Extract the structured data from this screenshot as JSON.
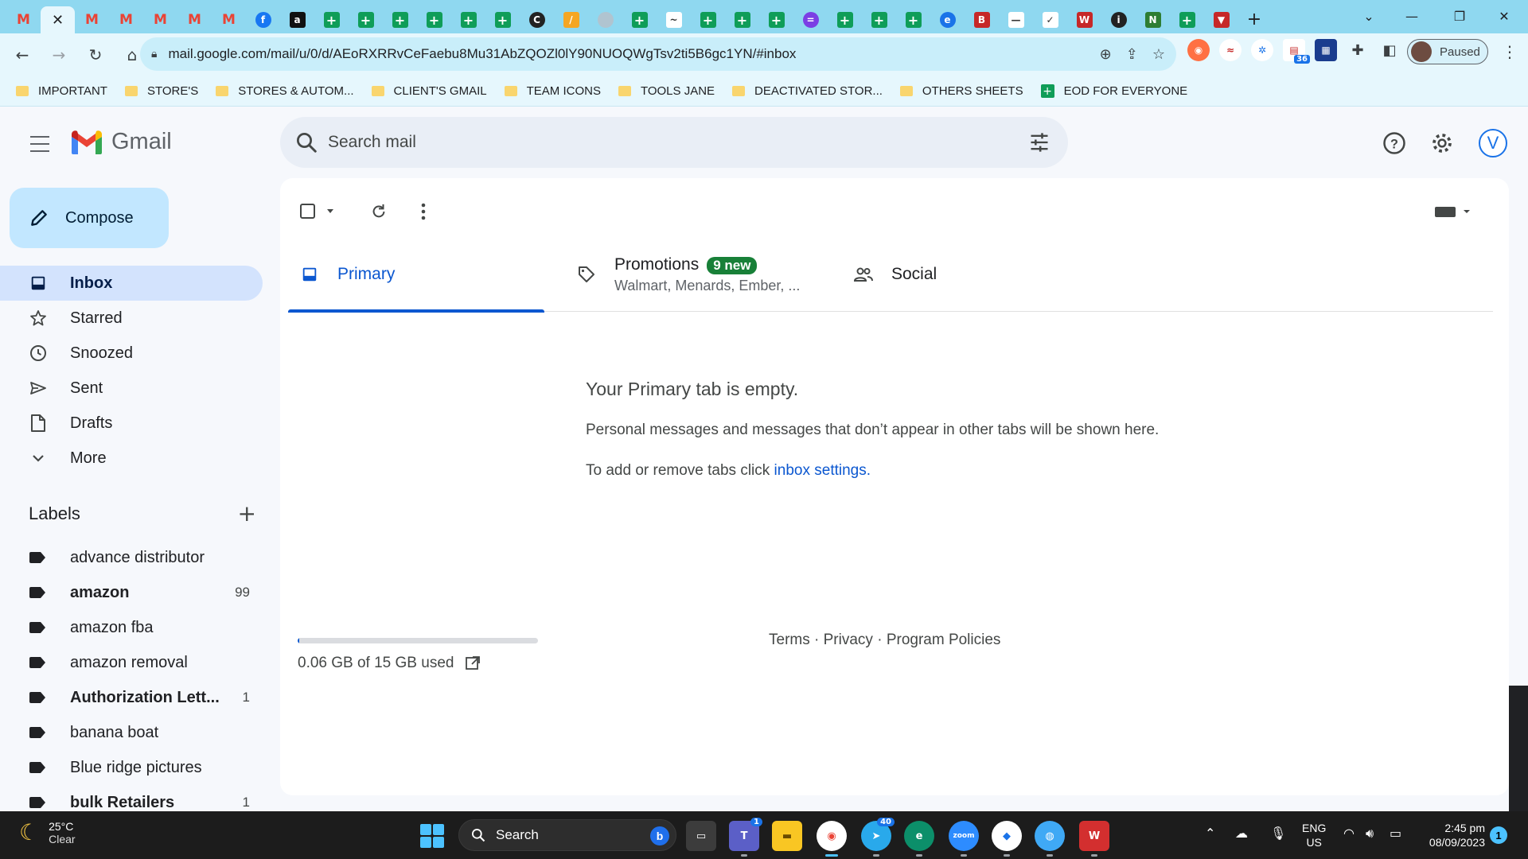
{
  "browser": {
    "tabs": [
      {
        "icon": "gmail-icon",
        "glyph": "M",
        "kind": "gmail"
      },
      {
        "icon": "gmail-icon",
        "glyph": "M",
        "kind": "gmail",
        "active": true
      },
      {
        "icon": "gmail-icon",
        "glyph": "M",
        "kind": "gmail"
      },
      {
        "icon": "gmail-icon",
        "glyph": "M",
        "kind": "gmail"
      },
      {
        "icon": "gmail-icon",
        "glyph": "M",
        "kind": "gmail"
      },
      {
        "icon": "gmail-icon",
        "glyph": "M",
        "kind": "gmail"
      },
      {
        "icon": "gmail-icon",
        "glyph": "M",
        "kind": "gmail"
      },
      {
        "icon": "facebook-icon",
        "glyph": "f",
        "kind": "fb"
      },
      {
        "icon": "amazon-icon",
        "glyph": "a",
        "kind": "amz"
      },
      {
        "icon": "sheets-icon",
        "glyph": "+",
        "kind": "sheet"
      },
      {
        "icon": "sheets-icon",
        "glyph": "+",
        "kind": "sheet"
      },
      {
        "icon": "sheets-icon",
        "glyph": "+",
        "kind": "sheet"
      },
      {
        "icon": "sheets-icon",
        "glyph": "+",
        "kind": "sheet"
      },
      {
        "icon": "sheets-icon",
        "glyph": "+",
        "kind": "sheet"
      },
      {
        "icon": "sheets-icon",
        "glyph": "+",
        "kind": "sheet"
      },
      {
        "icon": "circle-app-icon",
        "glyph": "C",
        "kind": "dark"
      },
      {
        "icon": "tool-icon",
        "glyph": "/",
        "kind": "tool"
      },
      {
        "icon": "grey-circle-icon",
        "glyph": "",
        "kind": "grey"
      },
      {
        "icon": "sheets-icon",
        "glyph": "+",
        "kind": "sheet"
      },
      {
        "icon": "wave-icon",
        "glyph": "~",
        "kind": "white"
      },
      {
        "icon": "sheets-icon",
        "glyph": "+",
        "kind": "sheet"
      },
      {
        "icon": "sheets-icon",
        "glyph": "+",
        "kind": "sheet"
      },
      {
        "icon": "sheets-icon",
        "glyph": "+",
        "kind": "sheet"
      },
      {
        "icon": "chat-bubble-icon",
        "glyph": "=",
        "kind": "purple"
      },
      {
        "icon": "sheets-icon",
        "glyph": "+",
        "kind": "sheet"
      },
      {
        "icon": "sheets-icon",
        "glyph": "+",
        "kind": "sheet"
      },
      {
        "icon": "sheets-icon",
        "glyph": "+",
        "kind": "sheet"
      },
      {
        "icon": "blue-circle-icon",
        "glyph": "e",
        "kind": "blue"
      },
      {
        "icon": "big-icon",
        "glyph": "B",
        "kind": "red"
      },
      {
        "icon": "white-bar-icon",
        "glyph": "—",
        "kind": "white"
      },
      {
        "icon": "check-icon",
        "glyph": "✓",
        "kind": "white"
      },
      {
        "icon": "vw-icon",
        "glyph": "W",
        "kind": "red"
      },
      {
        "icon": "italic-circle-icon",
        "glyph": "i",
        "kind": "dark"
      },
      {
        "icon": "n-icon",
        "glyph": "N",
        "kind": "green"
      },
      {
        "icon": "sheets-icon",
        "glyph": "+",
        "kind": "sheet"
      },
      {
        "icon": "funnel-icon",
        "glyph": "▼",
        "kind": "red"
      }
    ],
    "url": "mail.google.com/mail/u/0/d/AEoRXRRvCeFaebu8Mu31AbZQOZl0lY90NUOQWgTsv2ti5B6gc1YN/#inbox",
    "profile_label": "Paused",
    "extension_badge": "36",
    "bookmarks": [
      {
        "label": "IMPORTANT",
        "type": "folder"
      },
      {
        "label": "STORE'S",
        "type": "folder"
      },
      {
        "label": "STORES & AUTOM...",
        "type": "folder"
      },
      {
        "label": "CLIENT'S GMAIL",
        "type": "folder"
      },
      {
        "label": "TEAM ICONS",
        "type": "folder"
      },
      {
        "label": "TOOLS JANE",
        "type": "folder"
      },
      {
        "label": "DEACTIVATED STOR...",
        "type": "folder"
      },
      {
        "label": "OTHERS SHEETS",
        "type": "folder"
      },
      {
        "label": "EOD FOR EVERYONE",
        "type": "sheet"
      }
    ]
  },
  "gmail": {
    "wordmark": "Gmail",
    "search_placeholder": "Search mail",
    "account_initial": "V",
    "compose_label": "Compose",
    "nav": [
      {
        "label": "Inbox",
        "icon": "inbox-icon",
        "active": true
      },
      {
        "label": "Starred",
        "icon": "star-icon"
      },
      {
        "label": "Snoozed",
        "icon": "clock-icon"
      },
      {
        "label": "Sent",
        "icon": "send-icon"
      },
      {
        "label": "Drafts",
        "icon": "draft-icon"
      },
      {
        "label": "More",
        "icon": "chevron-down-icon"
      }
    ],
    "labels_title": "Labels",
    "labels": [
      {
        "name": "advance distributor",
        "count": "",
        "bold": false
      },
      {
        "name": "amazon",
        "count": "99",
        "bold": true
      },
      {
        "name": "amazon fba",
        "count": "",
        "bold": false
      },
      {
        "name": "amazon removal",
        "count": "",
        "bold": false
      },
      {
        "name": "Authorization Lett...",
        "count": "1",
        "bold": true
      },
      {
        "name": "banana boat",
        "count": "",
        "bold": false
      },
      {
        "name": "Blue ridge pictures",
        "count": "",
        "bold": false
      },
      {
        "name": "bulk Retailers",
        "count": "1",
        "bold": true
      }
    ],
    "tabs": {
      "primary": "Primary",
      "promotions": "Promotions",
      "promotions_badge": "9 new",
      "promotions_sub": "Walmart, Menards, Ember, ...",
      "social": "Social"
    },
    "empty": {
      "title": "Your Primary tab is empty.",
      "body": "Personal messages and messages that don’t appear in other tabs will be shown here.",
      "settings_prefix": "To add or remove tabs click ",
      "settings_link": "inbox settings",
      "settings_suffix": "."
    },
    "storage": {
      "text": "0.06 GB of 15 GB used",
      "fraction": 0.004
    },
    "footer": {
      "terms": "Terms",
      "privacy": "Privacy",
      "policies": "Program Policies",
      "separator": " · "
    }
  },
  "taskbar": {
    "weather_temp": "25°C",
    "weather_desc": "Clear",
    "search_label": "Search",
    "lang_top": "ENG",
    "lang_bottom": "US",
    "time": "2:45 pm",
    "date": "08/09/2023",
    "notification_count": "1",
    "teams_badge": "1",
    "telegram_badge": "40"
  }
}
